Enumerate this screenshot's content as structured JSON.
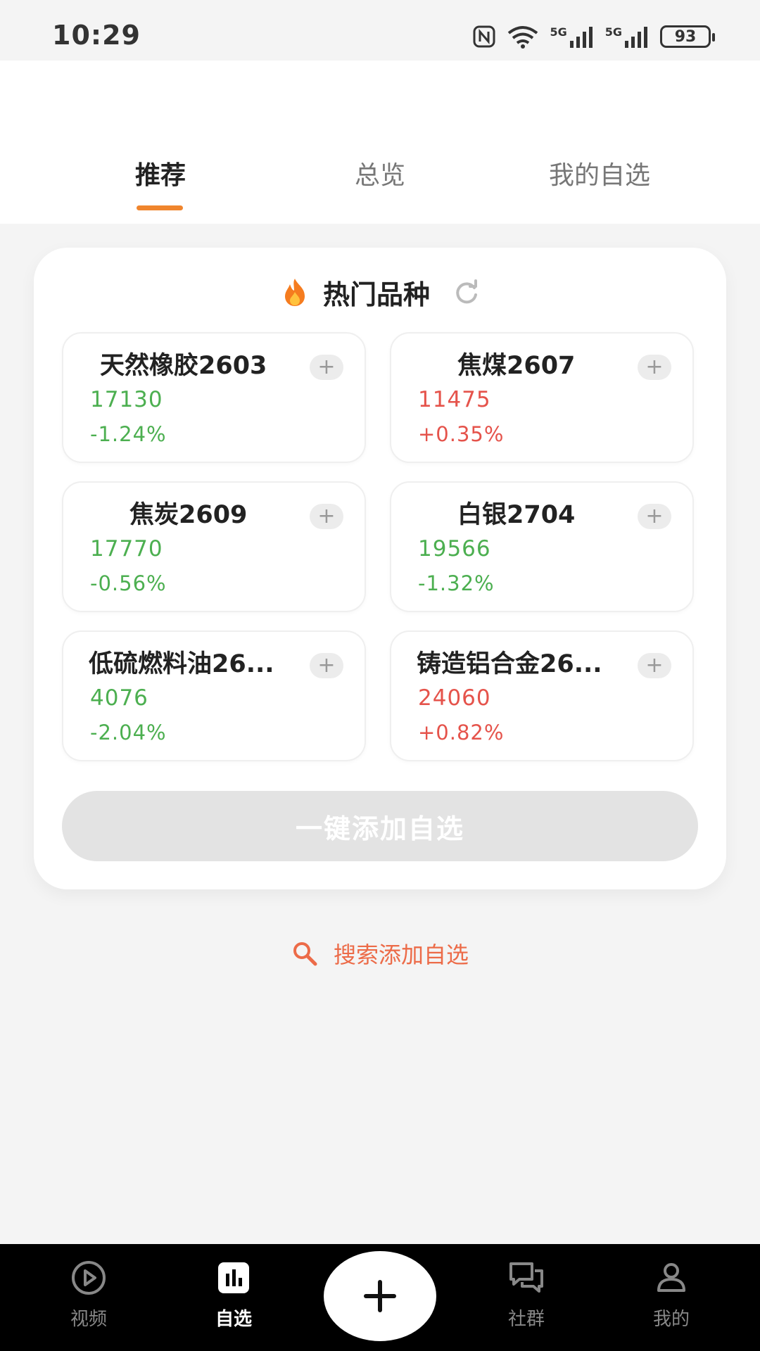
{
  "status_bar": {
    "time": "10:29",
    "battery": "93",
    "network_1": "5G",
    "network_2": "5G"
  },
  "tabs": [
    {
      "label": "推荐",
      "active": true
    },
    {
      "label": "总览",
      "active": false
    },
    {
      "label": "我的自选",
      "active": false
    }
  ],
  "hot_section": {
    "title": "热门品种",
    "items": [
      {
        "name": "天然橡胶2603",
        "price": "17130",
        "change": "-1.24%",
        "trend": "down"
      },
      {
        "name": "焦煤2607",
        "price": "11475",
        "change": "+0.35%",
        "trend": "up"
      },
      {
        "name": "焦炭2609",
        "price": "17770",
        "change": "-0.56%",
        "trend": "down"
      },
      {
        "name": "白银2704",
        "price": "19566",
        "change": "-1.32%",
        "trend": "down"
      },
      {
        "name": "低硫燃料油26...",
        "price": "4076",
        "change": "-2.04%",
        "trend": "down"
      },
      {
        "name": "铸造铝合金26...",
        "price": "24060",
        "change": "+0.82%",
        "trend": "up"
      }
    ],
    "add_all_label": "一键添加自选"
  },
  "search_link": {
    "label": "搜索添加自选"
  },
  "bottom_nav": [
    {
      "label": "视频",
      "icon": "play-icon",
      "active": false
    },
    {
      "label": "自选",
      "icon": "bar-chart-icon",
      "active": true
    },
    {
      "label": "",
      "icon": "plus-icon",
      "active": false
    },
    {
      "label": "社群",
      "icon": "chat-icon",
      "active": false
    },
    {
      "label": "我的",
      "icon": "person-icon",
      "active": false
    }
  ],
  "colors": {
    "accent": "#f0852d",
    "up": "#e5534b",
    "down": "#4caf50",
    "search": "#ec6b48"
  }
}
